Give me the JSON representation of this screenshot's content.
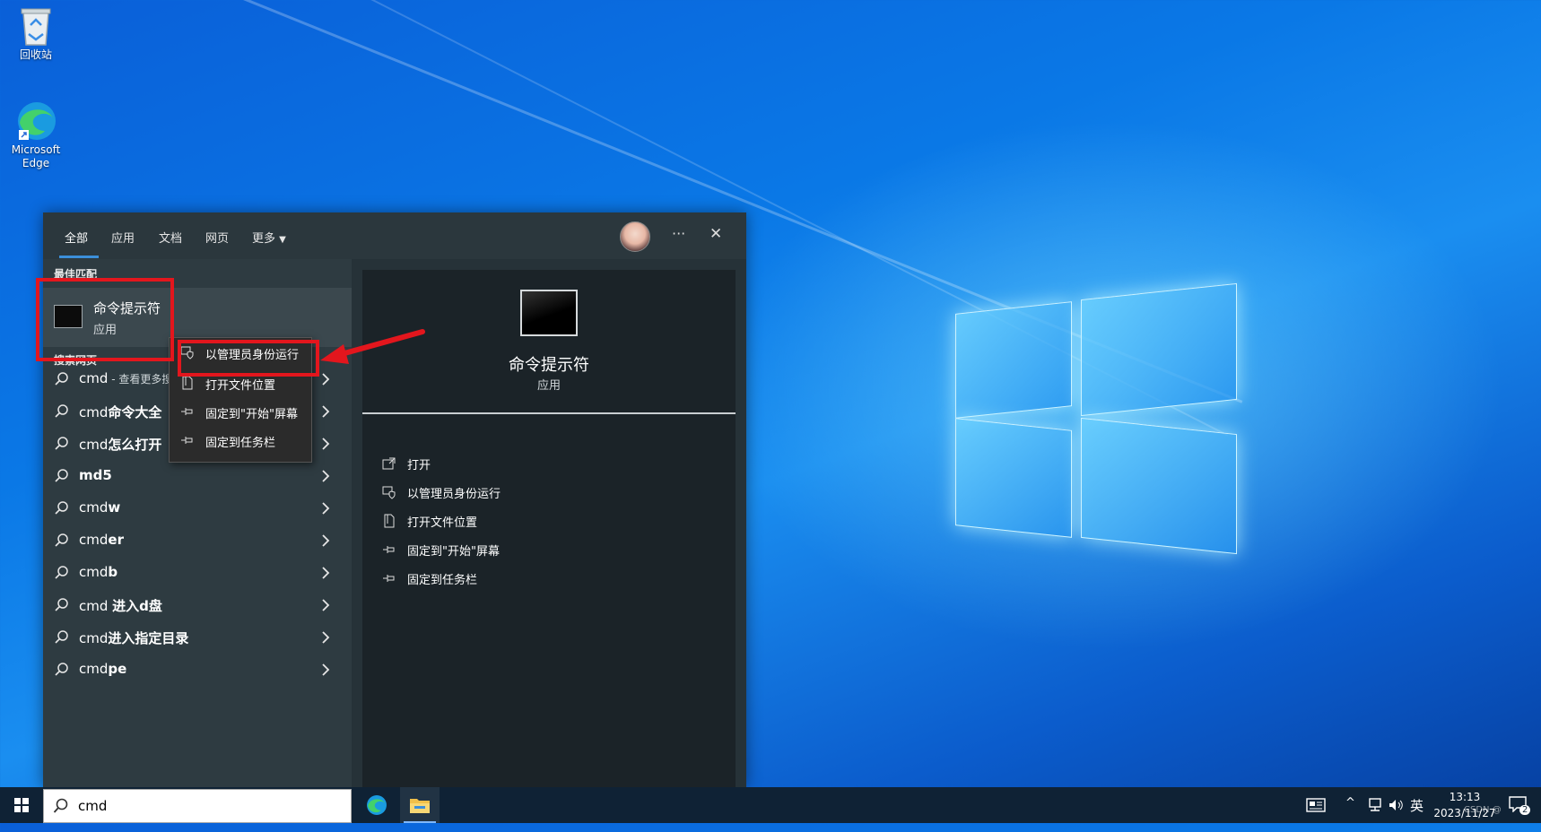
{
  "desktop": {
    "icons": [
      {
        "label": "回收站",
        "icon": "recycle-bin-icon"
      },
      {
        "label_line1": "Microsoft",
        "label_line2": "Edge",
        "icon": "edge-icon"
      }
    ]
  },
  "search_panel": {
    "tabs": [
      "全部",
      "应用",
      "文档",
      "网页",
      "更多"
    ],
    "best_match_header": "最佳匹配",
    "best_match": {
      "title": "命令提示符",
      "subtitle": "应用"
    },
    "web_header": "搜索网页",
    "web_results": [
      {
        "plain": "cmd",
        "bold": "",
        "suffix": " - 查看更多搜索结果"
      },
      {
        "plain": "cmd",
        "bold": "命令大全",
        "suffix": ""
      },
      {
        "plain": "cmd",
        "bold": "怎么打开",
        "suffix": ""
      },
      {
        "plain": "",
        "bold": "md5",
        "suffix": ""
      },
      {
        "plain": "cmd",
        "bold": "w",
        "suffix": ""
      },
      {
        "plain": "cmd",
        "bold": "er",
        "suffix": ""
      },
      {
        "plain": "cmd",
        "bold": "b",
        "suffix": ""
      },
      {
        "plain": "cmd ",
        "bold": "进入d盘",
        "suffix": ""
      },
      {
        "plain": "cmd",
        "bold": "进入指定目录",
        "suffix": ""
      },
      {
        "plain": "cmd",
        "bold": "pe",
        "suffix": ""
      }
    ],
    "detail": {
      "title": "命令提示符",
      "subtitle": "应用",
      "actions": [
        "打开",
        "以管理员身份运行",
        "打开文件位置",
        "固定到\"开始\"屏幕",
        "固定到任务栏"
      ]
    },
    "context_menu": [
      "以管理员身份运行",
      "打开文件位置",
      "固定到\"开始\"屏幕",
      "固定到任务栏"
    ],
    "more_glyph": "···",
    "close_glyph": "✕"
  },
  "taskbar": {
    "search_value": "cmd",
    "ime": "英",
    "time": "13:13",
    "date": "2023/11/27",
    "watermark": "CSDN @",
    "notif_count": "2"
  },
  "colors": {
    "annotation_red": "#e3161d",
    "accent": "#3b8fd9"
  }
}
